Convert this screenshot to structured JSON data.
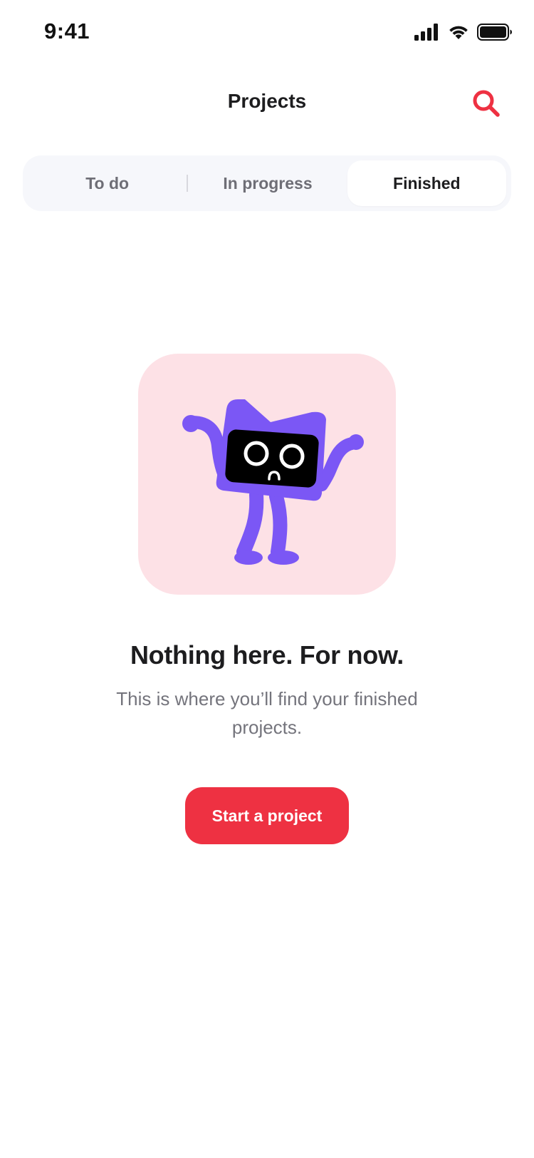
{
  "status_bar": {
    "time": "9:41",
    "icons": [
      "signal-icon",
      "wifi-icon",
      "battery-icon"
    ]
  },
  "nav": {
    "title": "Projects",
    "search_icon": "search-icon"
  },
  "tabs": [
    {
      "label": "To do",
      "active": false
    },
    {
      "label": "In progress",
      "active": false
    },
    {
      "label": "Finished",
      "active": true
    }
  ],
  "empty_state": {
    "illustration": "sad-folder-character",
    "title": "Nothing here. For now.",
    "subtitle": "This is where you’ll find your finished projects.",
    "cta_label": "Start a project"
  },
  "colors": {
    "accent": "#ee3142",
    "illustration_bg": "#fde1e6",
    "character": "#7b57f5",
    "segmented_bg": "#f6f7fb"
  }
}
